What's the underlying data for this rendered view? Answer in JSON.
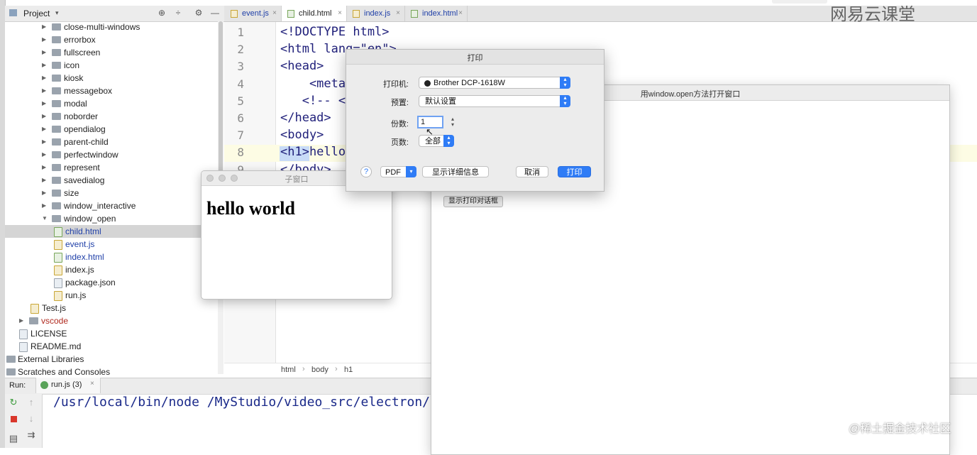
{
  "project_panel": {
    "title": "Project",
    "tree": [
      {
        "label": "close-multi-windows",
        "kind": "folder",
        "arrow": "▶"
      },
      {
        "label": "errorbox",
        "kind": "folder",
        "arrow": "▶"
      },
      {
        "label": "fullscreen",
        "kind": "folder",
        "arrow": "▶"
      },
      {
        "label": "icon",
        "kind": "folder",
        "arrow": "▶"
      },
      {
        "label": "kiosk",
        "kind": "folder",
        "arrow": "▶"
      },
      {
        "label": "messagebox",
        "kind": "folder",
        "arrow": "▶"
      },
      {
        "label": "modal",
        "kind": "folder",
        "arrow": "▶"
      },
      {
        "label": "noborder",
        "kind": "folder",
        "arrow": "▶"
      },
      {
        "label": "opendialog",
        "kind": "folder",
        "arrow": "▶"
      },
      {
        "label": "parent-child",
        "kind": "folder",
        "arrow": "▶"
      },
      {
        "label": "perfectwindow",
        "kind": "folder",
        "arrow": "▶"
      },
      {
        "label": "represent",
        "kind": "folder",
        "arrow": "▶"
      },
      {
        "label": "savedialog",
        "kind": "folder",
        "arrow": "▶"
      },
      {
        "label": "size",
        "kind": "folder",
        "arrow": "▶"
      },
      {
        "label": "window_interactive",
        "kind": "folder",
        "arrow": "▶"
      },
      {
        "label": "window_open",
        "kind": "folder",
        "arrow": "▼"
      },
      {
        "label": "child.html",
        "kind": "html"
      },
      {
        "label": "event.js",
        "kind": "js"
      },
      {
        "label": "index.html",
        "kind": "html"
      },
      {
        "label": "index.js",
        "kind": "js"
      },
      {
        "label": "package.json",
        "kind": "file"
      },
      {
        "label": "run.js",
        "kind": "js"
      },
      {
        "label": "Test.js",
        "kind": "js"
      },
      {
        "label": "vscode",
        "kind": "folder",
        "arrow": "▶"
      },
      {
        "label": "LICENSE",
        "kind": "file"
      },
      {
        "label": "README.md",
        "kind": "file"
      },
      {
        "label": "External Libraries",
        "kind": "lib"
      },
      {
        "label": "Scratches and Consoles",
        "kind": "scratch"
      }
    ]
  },
  "tabs": [
    {
      "label": "event.js",
      "kind": "js"
    },
    {
      "label": "child.html",
      "kind": "html"
    },
    {
      "label": "index.js",
      "kind": "js"
    },
    {
      "label": "index.html",
      "kind": "html"
    }
  ],
  "active_tab": "child.html",
  "editor": {
    "line_numbers": [
      "1",
      "2",
      "3",
      "4",
      "5",
      "6",
      "7",
      "8",
      "9"
    ],
    "lines": [
      "<!DOCTYPE html>",
      "<html lang=\"en\">",
      "<head>",
      "    <meta",
      "   <!-- <",
      "</head>",
      "<body>",
      "<h1>hello",
      "</body>"
    ],
    "breadcrumb": [
      "html",
      "body",
      "h1"
    ]
  },
  "run_panel": {
    "label": "Run:",
    "tab_label": "run.js (3)",
    "console_line": "/usr/local/bin/node /MyStudio/video_src/electron/s"
  },
  "child_window": {
    "title": "子窗口",
    "heading": "hello world"
  },
  "main_window": {
    "title": "用window.open方法打开窗口",
    "show_print_button": "显示打印对话框"
  },
  "print_dialog": {
    "title": "打印",
    "printer_label": "打印机:",
    "printer_value": "Brother DCP-1618W",
    "preset_label": "预置:",
    "preset_value": "默认设置",
    "copies_label": "份数:",
    "copies_value": "1",
    "pages_label": "页数:",
    "pages_value": "全部",
    "help_symbol": "?",
    "pdf_label": "PDF",
    "details_button": "显示详细信息",
    "cancel_button": "取消",
    "print_button": "打印"
  },
  "watermarks": {
    "top": "网易云课堂",
    "bottom": "@稀土掘金技术社区"
  },
  "colors": {
    "accent": "#2f7cf6",
    "link": "#2040a8",
    "highlight_line": "#fdfce4"
  }
}
